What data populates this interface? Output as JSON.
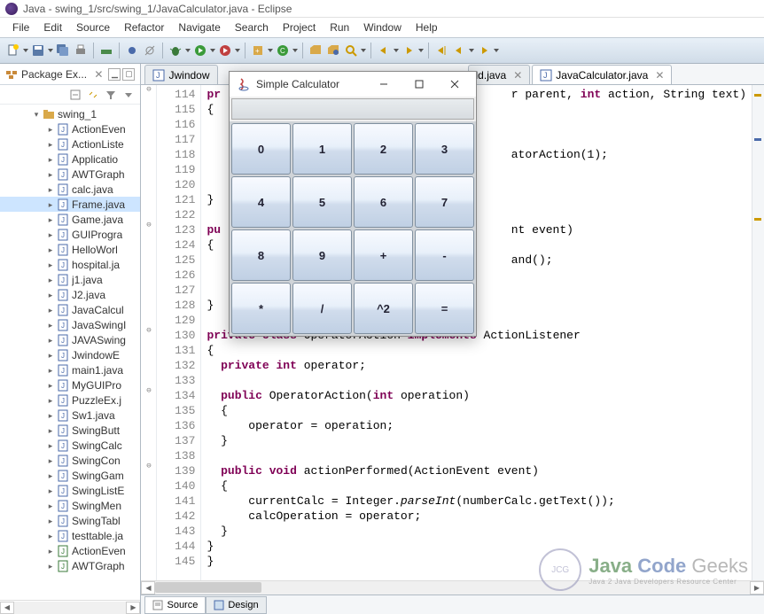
{
  "window": {
    "title": "Java - swing_1/src/swing_1/JavaCalculator.java - Eclipse"
  },
  "menubar": [
    "File",
    "Edit",
    "Source",
    "Refactor",
    "Navigate",
    "Search",
    "Project",
    "Run",
    "Window",
    "Help"
  ],
  "pkg_explorer": {
    "title": "Package Ex...",
    "project": "swing_1",
    "files": [
      "ActionEven",
      "ActionListe",
      "Applicatio",
      "AWTGraph",
      "calc.java",
      "Frame.java",
      "Game.java",
      "GUIProgra",
      "HelloWorl",
      "hospital.ja",
      "j1.java",
      "J2.java",
      "JavaCalcul",
      "JavaSwingI",
      "JAVASwing",
      "JwindowE",
      "main1.java",
      "MyGUIPro",
      "PuzzleEx.j",
      "Sw1.java",
      "SwingButt",
      "SwingCalc",
      "SwingCon",
      "SwingGam",
      "SwingListE",
      "SwingMen",
      "SwingTabl",
      "testtable.ja",
      "ActionEven",
      "AWTGraph"
    ],
    "selected_index": 5
  },
  "editor": {
    "tabs": [
      {
        "label": "Jwindow",
        "active": false
      },
      {
        "label": "ld.java",
        "active": false,
        "gap": true
      },
      {
        "label": "JavaCalculator.java",
        "active": true
      }
    ],
    "first_line": 114,
    "bottom_tabs": [
      "Source",
      "Design"
    ],
    "active_bottom": 0
  },
  "code_fragments": {
    "l114a": "pr",
    "l114b": "r parent, ",
    "l114c": "int",
    "l114d": " action, String text)",
    "l115": "{",
    "l118a": "atorAction(1);",
    "l121": "}",
    "l123a": "pu",
    "l123b": "nt event)",
    "l124": "{",
    "l125a": "and();",
    "l128": "}",
    "l130a": "private",
    "l130b": " class",
    "l130c": " OperatorAction ",
    "l130d": "implements",
    "l130e": " ActionListener",
    "l131": "{",
    "l132a": "  private",
    "l132b": " int",
    "l132c": " operator;",
    "l134a": "  public",
    "l134b": " OperatorAction(",
    "l134c": "int",
    "l134d": " operation)",
    "l135": "  {",
    "l136a": "      operator = operation;",
    "l137": "  }",
    "l139a": "  public",
    "l139b": " void",
    "l139c": " actionPerformed(ActionEvent event)",
    "l140": "  {",
    "l141a": "      currentCalc = Integer.",
    "l141b": "parseInt",
    "l141c": "(numberCalc.getText());",
    "l142": "      calcOperation = operator;",
    "l143": "  }",
    "l144": "}",
    "l145": "}"
  },
  "calculator": {
    "title": "Simple Calculator",
    "buttons": [
      "0",
      "1",
      "2",
      "3",
      "4",
      "5",
      "6",
      "7",
      "8",
      "9",
      "+",
      "-",
      "*",
      "/",
      "^2",
      "="
    ]
  },
  "watermark": {
    "brand_a": "Java",
    "brand_b": "Code",
    "brand_c": "Geeks",
    "sub": "Java 2 Java Developers Resource Center"
  }
}
